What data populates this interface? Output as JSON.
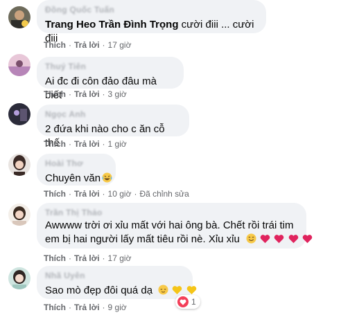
{
  "actions": {
    "like": "Thích",
    "reply": "Trả lời",
    "separator": "·"
  },
  "comments": [
    {
      "author": "Đồng Quốc Tuấn",
      "tag": "Trang Heo Trần Đình Trọng",
      "text": " cười điii ... cười điii",
      "time": "17 giờ",
      "edited": ""
    },
    {
      "author": "Thuý Tiên",
      "text": "Ai đc đi côn đảo đâu mà biết",
      "time": "3 giờ",
      "edited": ""
    },
    {
      "author": "Ngọc Anh",
      "text": "2 đứa khi nào cho c ăn cỗ thế",
      "time": "1 giờ",
      "edited": ""
    },
    {
      "author": "Hoài Thơ",
      "text": "Chuyên văn",
      "time": "10 giờ",
      "edited": "Đã chỉnh sửa"
    },
    {
      "author": "Trần Thị Thảo",
      "text_line1": "Awwww trời ơi xỉu mất với hai ông bà. Chết rồi trái tim",
      "text_line2": "em bị hai người lấy mất tiêu rồi nè. Xỉu xỉu",
      "time": "17 giờ",
      "edited": ""
    },
    {
      "author": "Nhã Uyên",
      "text": "Sao mò đẹp đôi quá dạ",
      "time": "9 giờ",
      "edited": "",
      "reaction_count": "1"
    }
  ],
  "icons": {
    "love": "heart-reaction-icon",
    "laugh": "laughing-emoji-icon",
    "smile": "smiling-emoji-icon",
    "relieved": "relieved-emoji-icon",
    "yellow_heart": "yellow-heart-icon",
    "red_heart": "red-heart-icon"
  },
  "colors": {
    "bubble": "#f0f2f5",
    "meta": "#65676b",
    "text": "#050505",
    "love": "#f33e58",
    "heart_red": "#e0245e",
    "heart_yellow": "#f5c518"
  }
}
